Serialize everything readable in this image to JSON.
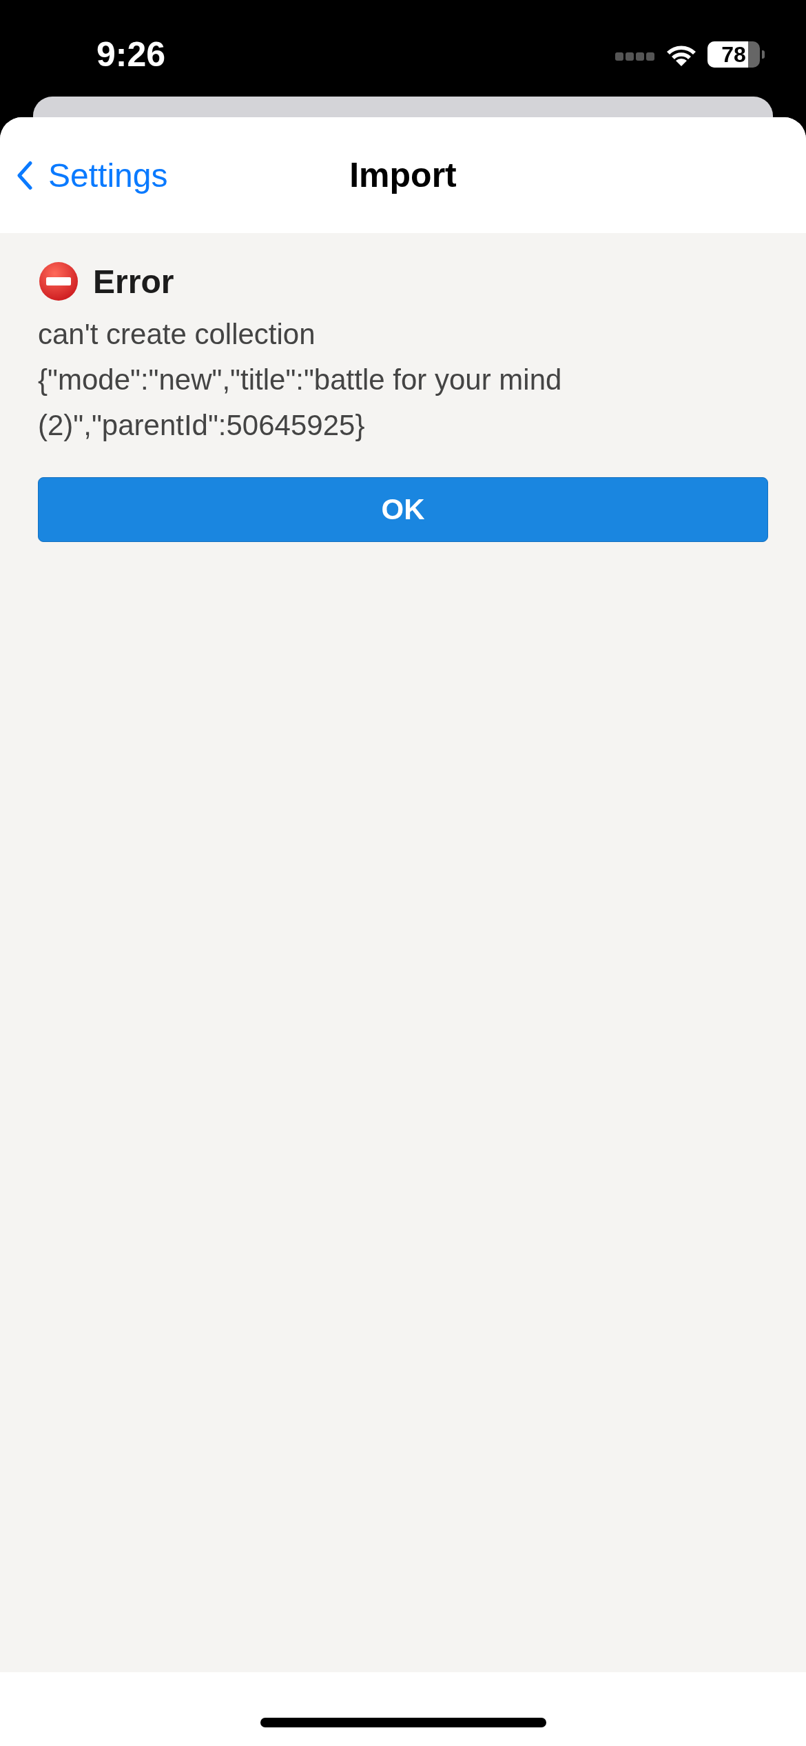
{
  "status_bar": {
    "time": "9:26",
    "battery": {
      "text": "78",
      "level": 0.78
    }
  },
  "nav": {
    "back": "Settings",
    "title": "Import"
  },
  "error": {
    "title": "Error",
    "message": "can't create collection\n{\"mode\":\"new\",\"title\":\"battle for your mind (2)\",\"parentId\":50645925}"
  },
  "buttons": [
    "OK"
  ]
}
